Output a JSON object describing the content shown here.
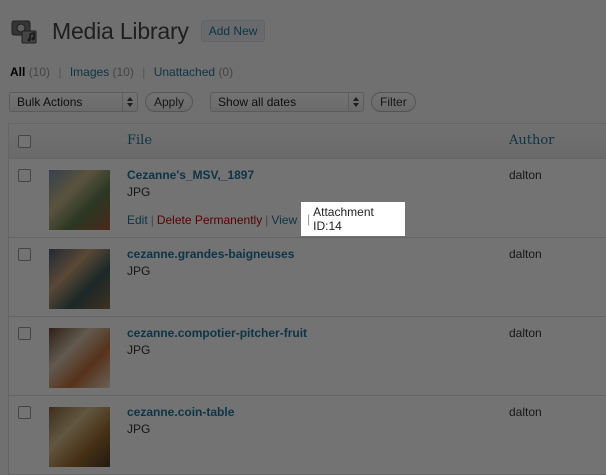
{
  "header": {
    "title": "Media Library",
    "add_new_label": "Add New"
  },
  "filters": [
    {
      "label": "All",
      "count": "(10)",
      "current": true
    },
    {
      "label": "Images",
      "count": "(10)",
      "current": false
    },
    {
      "label": "Unattached",
      "count": "(0)",
      "current": false
    }
  ],
  "toolbar": {
    "bulk_actions": "Bulk Actions",
    "apply_label": "Apply",
    "dates_filter": "Show all dates",
    "filter_label": "Filter"
  },
  "table": {
    "columns": {
      "file": "File",
      "author": "Author"
    },
    "rows": [
      {
        "file": "Cezanne's_MSV,_1897",
        "type": "JPG",
        "author": "dalton",
        "colors": [
          "#7a8fb0",
          "#c9b98a",
          "#5f7a4e",
          "#a85a3a"
        ]
      },
      {
        "file": "cezanne.grandes-baigneuses",
        "type": "JPG",
        "author": "dalton",
        "colors": [
          "#4a5e7a",
          "#c8a078",
          "#3e5a5a",
          "#8b6b4a"
        ]
      },
      {
        "file": "cezanne.compotier-pitcher-fruit",
        "type": "JPG",
        "author": "dalton",
        "colors": [
          "#6a4a38",
          "#d8c8b0",
          "#c0703a",
          "#e8d8c0"
        ]
      },
      {
        "file": "cezanne.coin-table",
        "type": "JPG",
        "author": "dalton",
        "colors": [
          "#8a6a3a",
          "#d8c090",
          "#a07030",
          "#4a3a28"
        ]
      }
    ]
  },
  "row_actions": {
    "edit": "Edit",
    "delete": "Delete Permanently",
    "view": "View",
    "attachment_id": "Attachment ID:14"
  },
  "colors": {
    "link": "#21759b",
    "delete": "#bc0b0b",
    "overlay": "rgba(0,0,0,0.55)"
  }
}
